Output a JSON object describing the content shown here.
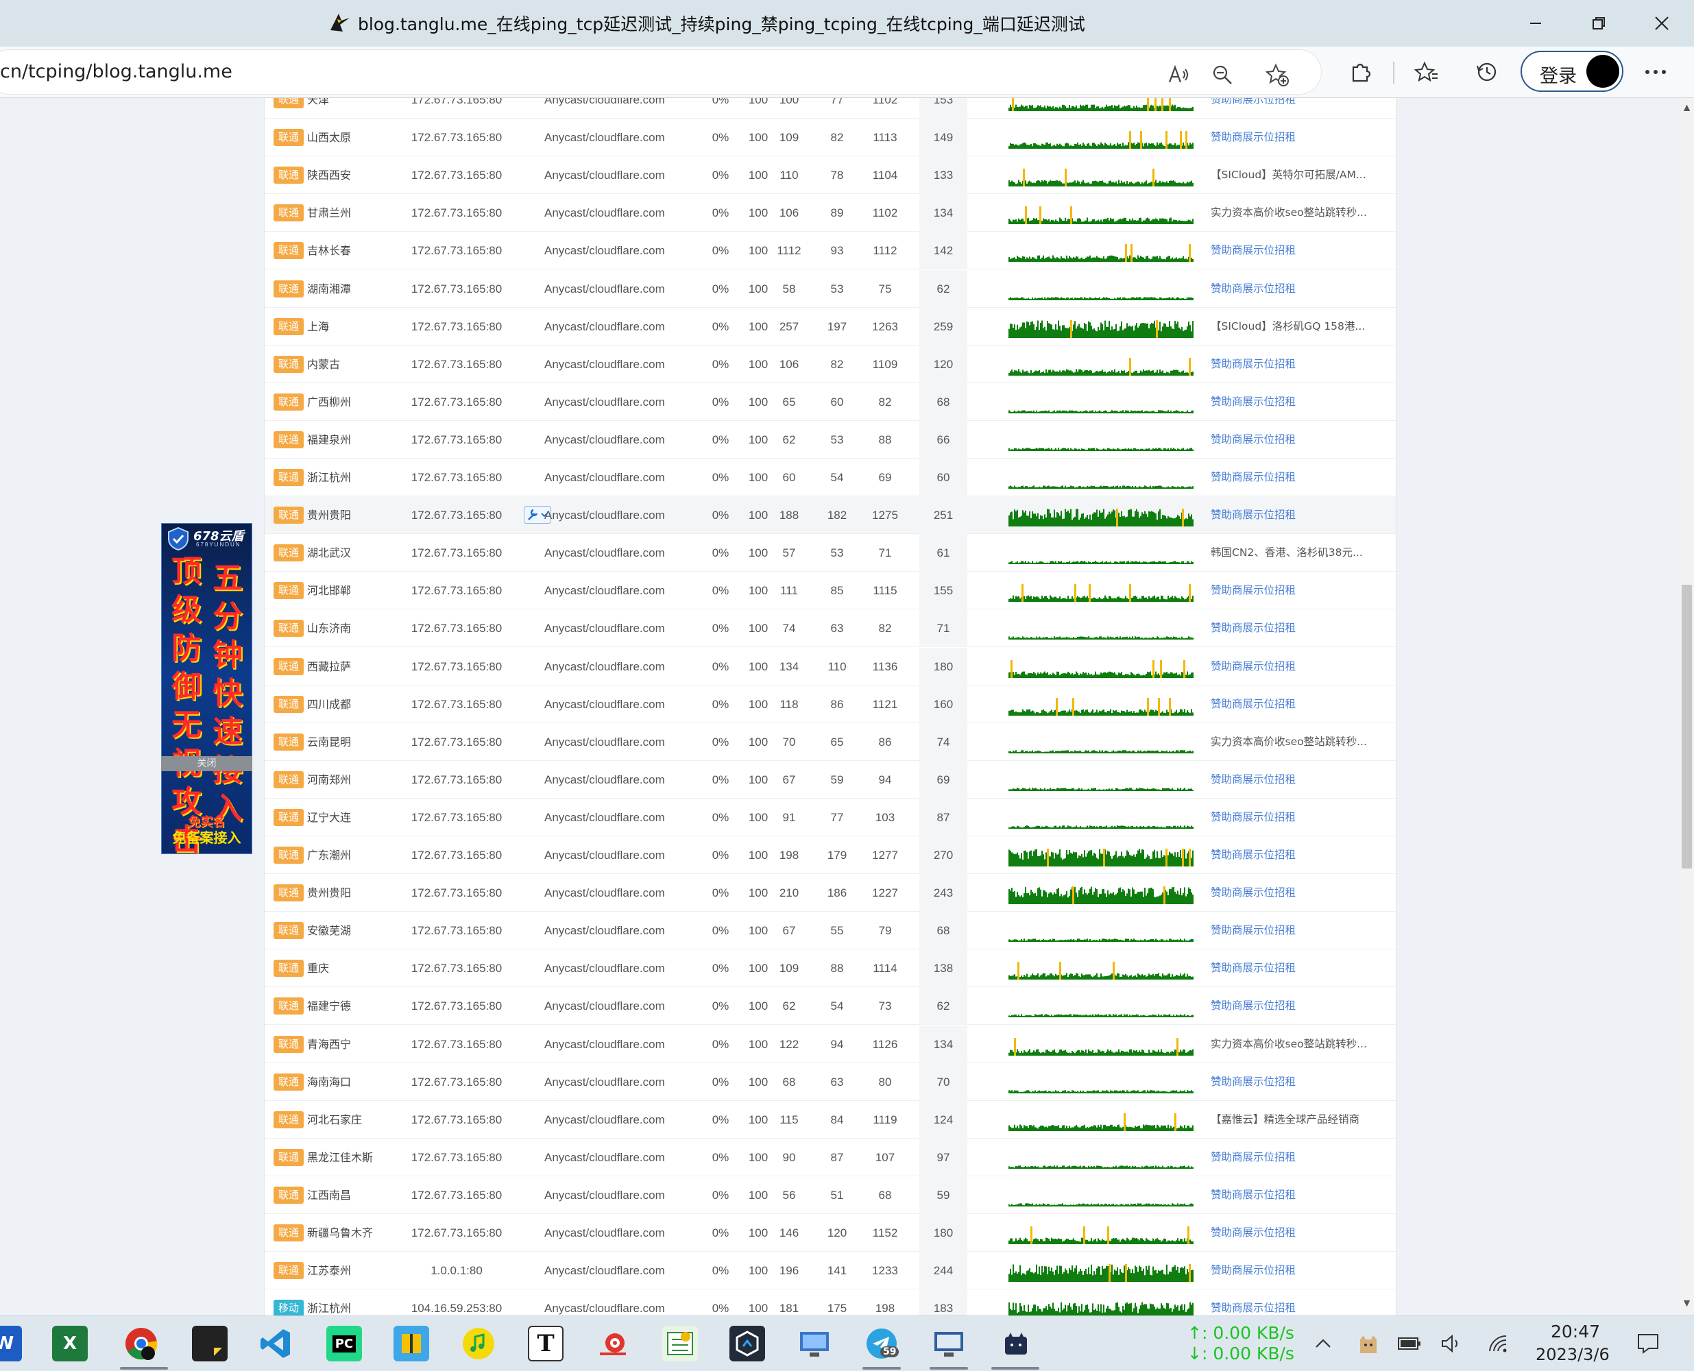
{
  "window": {
    "title": "blog.tanglu.me_在线ping_tcp延迟测试_持续ping_禁ping_tcping_在线tcping_端口延迟测试"
  },
  "browser": {
    "url": "cn/tcping/blog.tanglu.me",
    "login_label": "登录"
  },
  "side_ad": {
    "brand": "678云盾",
    "sub": "678YUNDUN",
    "col1": [
      "顶",
      "级",
      "防",
      "御",
      "无",
      "视",
      "攻",
      "击"
    ],
    "col2": [
      "五",
      "分",
      "钟",
      "快",
      "速",
      "接",
      "入"
    ],
    "foot1": "免实名",
    "foot2": "免备案接入",
    "close": "关闭"
  },
  "colors": {
    "isp_unicom": "#f5a944",
    "isp_mobile": "#35b6d3",
    "graph_ok": "#0f7d0f",
    "graph_spike": "#f2b800",
    "ad_link": "#4a7fd6"
  },
  "rows": [
    {
      "isp": "联通",
      "loc": "天津",
      "ip": "172.67.73.165:80",
      "domain": "Anycast/cloudflare.com",
      "loss": "0%",
      "sent": "100",
      "avg": "100",
      "min": "77",
      "max": "1102",
      "last": "153",
      "ad": "赞助商展示位招租",
      "ad_link": true,
      "level": "mid",
      "spikes": [
        0.02,
        0.76,
        0.8,
        0.84,
        0.88
      ]
    },
    {
      "isp": "联通",
      "loc": "山西太原",
      "ip": "172.67.73.165:80",
      "domain": "Anycast/cloudflare.com",
      "loss": "0%",
      "sent": "100",
      "avg": "109",
      "min": "82",
      "max": "1113",
      "last": "149",
      "ad": "赞助商展示位招租",
      "ad_link": true,
      "level": "mid",
      "spikes": [
        0.66,
        0.72,
        0.86,
        0.94,
        0.97
      ]
    },
    {
      "isp": "联通",
      "loc": "陕西西安",
      "ip": "172.67.73.165:80",
      "domain": "Anycast/cloudflare.com",
      "loss": "0%",
      "sent": "100",
      "avg": "110",
      "min": "78",
      "max": "1104",
      "last": "133",
      "ad": "【SICloud】英特尔可拓展/AM...",
      "ad_link": false,
      "level": "mid",
      "spikes": [
        0.08,
        0.31,
        0.79
      ]
    },
    {
      "isp": "联通",
      "loc": "甘肃兰州",
      "ip": "172.67.73.165:80",
      "domain": "Anycast/cloudflare.com",
      "loss": "0%",
      "sent": "100",
      "avg": "106",
      "min": "89",
      "max": "1102",
      "last": "134",
      "ad": "实力资本高价收seo整站跳转秒...",
      "ad_link": false,
      "level": "mid",
      "spikes": [
        0.09,
        0.17,
        0.34
      ]
    },
    {
      "isp": "联通",
      "loc": "吉林长春",
      "ip": "172.67.73.165:80",
      "domain": "Anycast/cloudflare.com",
      "loss": "0%",
      "sent": "100",
      "avg": "1112",
      "min": "93",
      "max": "1112",
      "last": "142",
      "ad": "赞助商展示位招租",
      "ad_link": true,
      "level": "mid",
      "spikes": [
        0.64,
        0.67,
        0.99
      ]
    },
    {
      "isp": "联通",
      "loc": "湖南湘潭",
      "ip": "172.67.73.165:80",
      "domain": "Anycast/cloudflare.com",
      "loss": "0%",
      "sent": "100",
      "avg": "58",
      "min": "53",
      "max": "75",
      "last": "62",
      "ad": "赞助商展示位招租",
      "ad_link": true,
      "level": "low",
      "spikes": []
    },
    {
      "isp": "联通",
      "loc": "上海",
      "ip": "172.67.73.165:80",
      "domain": "Anycast/cloudflare.com",
      "loss": "0%",
      "sent": "100",
      "avg": "257",
      "min": "197",
      "max": "1263",
      "last": "259",
      "ad": "【SICloud】洛杉矶GQ 158港...",
      "ad_link": false,
      "level": "high",
      "spikes": [
        0.34,
        0.81
      ]
    },
    {
      "isp": "联通",
      "loc": "内蒙古",
      "ip": "172.67.73.165:80",
      "domain": "Anycast/cloudflare.com",
      "loss": "0%",
      "sent": "100",
      "avg": "106",
      "min": "82",
      "max": "1109",
      "last": "120",
      "ad": "赞助商展示位招租",
      "ad_link": true,
      "level": "mid",
      "spikes": [
        0.66,
        0.99
      ]
    },
    {
      "isp": "联通",
      "loc": "广西柳州",
      "ip": "172.67.73.165:80",
      "domain": "Anycast/cloudflare.com",
      "loss": "0%",
      "sent": "100",
      "avg": "65",
      "min": "60",
      "max": "82",
      "last": "68",
      "ad": "赞助商展示位招租",
      "ad_link": true,
      "level": "low",
      "spikes": []
    },
    {
      "isp": "联通",
      "loc": "福建泉州",
      "ip": "172.67.73.165:80",
      "domain": "Anycast/cloudflare.com",
      "loss": "0%",
      "sent": "100",
      "avg": "62",
      "min": "53",
      "max": "88",
      "last": "66",
      "ad": "赞助商展示位招租",
      "ad_link": true,
      "level": "low",
      "spikes": []
    },
    {
      "isp": "联通",
      "loc": "浙江杭州",
      "ip": "172.67.73.165:80",
      "domain": "Anycast/cloudflare.com",
      "loss": "0%",
      "sent": "100",
      "avg": "60",
      "min": "54",
      "max": "69",
      "last": "60",
      "ad": "赞助商展示位招租",
      "ad_link": true,
      "level": "low",
      "spikes": []
    },
    {
      "isp": "联通",
      "loc": "贵州贵阳",
      "ip": "172.67.73.165:80",
      "domain": "Anycast/cloudflare.com",
      "loss": "0%",
      "sent": "100",
      "avg": "188",
      "min": "182",
      "max": "1275",
      "last": "251",
      "ad": "赞助商展示位招租",
      "ad_link": true,
      "level": "high",
      "spikes": [
        0.59,
        0.95
      ],
      "tool": true,
      "highlight": true
    },
    {
      "isp": "联通",
      "loc": "湖北武汉",
      "ip": "172.67.73.165:80",
      "domain": "Anycast/cloudflare.com",
      "loss": "0%",
      "sent": "100",
      "avg": "57",
      "min": "53",
      "max": "71",
      "last": "61",
      "ad": "韩国CN2、香港、洛杉矶38元...",
      "ad_link": false,
      "level": "low",
      "spikes": []
    },
    {
      "isp": "联通",
      "loc": "河北邯郸",
      "ip": "172.67.73.165:80",
      "domain": "Anycast/cloudflare.com",
      "loss": "0%",
      "sent": "100",
      "avg": "111",
      "min": "85",
      "max": "1115",
      "last": "155",
      "ad": "赞助商展示位招租",
      "ad_link": true,
      "level": "mid",
      "spikes": [
        0.07,
        0.36,
        0.44,
        0.66,
        0.99
      ]
    },
    {
      "isp": "联通",
      "loc": "山东济南",
      "ip": "172.67.73.165:80",
      "domain": "Anycast/cloudflare.com",
      "loss": "0%",
      "sent": "100",
      "avg": "74",
      "min": "63",
      "max": "82",
      "last": "71",
      "ad": "赞助商展示位招租",
      "ad_link": true,
      "level": "low",
      "spikes": []
    },
    {
      "isp": "联通",
      "loc": "西藏拉萨",
      "ip": "172.67.73.165:80",
      "domain": "Anycast/cloudflare.com",
      "loss": "0%",
      "sent": "100",
      "avg": "134",
      "min": "110",
      "max": "1136",
      "last": "180",
      "ad": "赞助商展示位招租",
      "ad_link": true,
      "level": "mid",
      "spikes": [
        0.01,
        0.79,
        0.83,
        0.96
      ]
    },
    {
      "isp": "联通",
      "loc": "四川成都",
      "ip": "172.67.73.165:80",
      "domain": "Anycast/cloudflare.com",
      "loss": "0%",
      "sent": "100",
      "avg": "118",
      "min": "86",
      "max": "1121",
      "last": "160",
      "ad": "赞助商展示位招租",
      "ad_link": true,
      "level": "mid",
      "spikes": [
        0.26,
        0.35,
        0.76,
        0.82,
        0.88
      ]
    },
    {
      "isp": "联通",
      "loc": "云南昆明",
      "ip": "172.67.73.165:80",
      "domain": "Anycast/cloudflare.com",
      "loss": "0%",
      "sent": "100",
      "avg": "70",
      "min": "65",
      "max": "86",
      "last": "74",
      "ad": "实力资本高价收seo整站跳转秒...",
      "ad_link": false,
      "level": "low",
      "spikes": []
    },
    {
      "isp": "联通",
      "loc": "河南郑州",
      "ip": "172.67.73.165:80",
      "domain": "Anycast/cloudflare.com",
      "loss": "0%",
      "sent": "100",
      "avg": "67",
      "min": "59",
      "max": "94",
      "last": "69",
      "ad": "赞助商展示位招租",
      "ad_link": true,
      "level": "low",
      "spikes": []
    },
    {
      "isp": "联通",
      "loc": "辽宁大连",
      "ip": "172.67.73.165:80",
      "domain": "Anycast/cloudflare.com",
      "loss": "0%",
      "sent": "100",
      "avg": "91",
      "min": "77",
      "max": "103",
      "last": "87",
      "ad": "赞助商展示位招租",
      "ad_link": true,
      "level": "low",
      "spikes": []
    },
    {
      "isp": "联通",
      "loc": "广东潮州",
      "ip": "172.67.73.165:80",
      "domain": "Anycast/cloudflare.com",
      "loss": "0%",
      "sent": "100",
      "avg": "198",
      "min": "179",
      "max": "1277",
      "last": "270",
      "ad": "赞助商展示位招租",
      "ad_link": true,
      "level": "high",
      "spikes": [
        0.21,
        0.52,
        0.86,
        0.95,
        0.99
      ]
    },
    {
      "isp": "联通",
      "loc": "贵州贵阳",
      "ip": "172.67.73.165:80",
      "domain": "Anycast/cloudflare.com",
      "loss": "0%",
      "sent": "100",
      "avg": "210",
      "min": "186",
      "max": "1227",
      "last": "243",
      "ad": "赞助商展示位招租",
      "ad_link": true,
      "level": "high",
      "spikes": [
        0.35,
        0.85
      ]
    },
    {
      "isp": "联通",
      "loc": "安徽芜湖",
      "ip": "172.67.73.165:80",
      "domain": "Anycast/cloudflare.com",
      "loss": "0%",
      "sent": "100",
      "avg": "67",
      "min": "55",
      "max": "79",
      "last": "68",
      "ad": "赞助商展示位招租",
      "ad_link": true,
      "level": "low",
      "spikes": []
    },
    {
      "isp": "联通",
      "loc": "重庆",
      "ip": "172.67.73.165:80",
      "domain": "Anycast/cloudflare.com",
      "loss": "0%",
      "sent": "100",
      "avg": "109",
      "min": "88",
      "max": "1114",
      "last": "138",
      "ad": "赞助商展示位招租",
      "ad_link": true,
      "level": "mid",
      "spikes": [
        0.05,
        0.28,
        0.57
      ]
    },
    {
      "isp": "联通",
      "loc": "福建宁德",
      "ip": "172.67.73.165:80",
      "domain": "Anycast/cloudflare.com",
      "loss": "0%",
      "sent": "100",
      "avg": "62",
      "min": "54",
      "max": "73",
      "last": "62",
      "ad": "赞助商展示位招租",
      "ad_link": true,
      "level": "low",
      "spikes": []
    },
    {
      "isp": "联通",
      "loc": "青海西宁",
      "ip": "172.67.73.165:80",
      "domain": "Anycast/cloudflare.com",
      "loss": "0%",
      "sent": "100",
      "avg": "122",
      "min": "94",
      "max": "1126",
      "last": "134",
      "ad": "实力资本高价收seo整站跳转秒...",
      "ad_link": false,
      "level": "mid",
      "spikes": [
        0.03,
        0.92
      ]
    },
    {
      "isp": "联通",
      "loc": "海南海口",
      "ip": "172.67.73.165:80",
      "domain": "Anycast/cloudflare.com",
      "loss": "0%",
      "sent": "100",
      "avg": "68",
      "min": "63",
      "max": "80",
      "last": "70",
      "ad": "赞助商展示位招租",
      "ad_link": true,
      "level": "low",
      "spikes": []
    },
    {
      "isp": "联通",
      "loc": "河北石家庄",
      "ip": "172.67.73.165:80",
      "domain": "Anycast/cloudflare.com",
      "loss": "0%",
      "sent": "100",
      "avg": "115",
      "min": "84",
      "max": "1119",
      "last": "124",
      "ad": "【嘉惟云】精选全球产品经销商",
      "ad_link": false,
      "level": "mid",
      "spikes": [
        0.63,
        0.91
      ]
    },
    {
      "isp": "联通",
      "loc": "黑龙江佳木斯",
      "ip": "172.67.73.165:80",
      "domain": "Anycast/cloudflare.com",
      "loss": "0%",
      "sent": "100",
      "avg": "90",
      "min": "87",
      "max": "107",
      "last": "97",
      "ad": "赞助商展示位招租",
      "ad_link": true,
      "level": "low",
      "spikes": []
    },
    {
      "isp": "联通",
      "loc": "江西南昌",
      "ip": "172.67.73.165:80",
      "domain": "Anycast/cloudflare.com",
      "loss": "0%",
      "sent": "100",
      "avg": "56",
      "min": "51",
      "max": "68",
      "last": "59",
      "ad": "赞助商展示位招租",
      "ad_link": true,
      "level": "low",
      "spikes": []
    },
    {
      "isp": "联通",
      "loc": "新疆乌鲁木齐",
      "ip": "172.67.73.165:80",
      "domain": "Anycast/cloudflare.com",
      "loss": "0%",
      "sent": "100",
      "avg": "146",
      "min": "120",
      "max": "1152",
      "last": "180",
      "ad": "赞助商展示位招租",
      "ad_link": true,
      "level": "mid",
      "spikes": [
        0.12,
        0.41,
        0.54,
        0.98
      ]
    },
    {
      "isp": "联通",
      "loc": "江苏泰州",
      "ip": "1.0.0.1:80",
      "domain": "Anycast/cloudflare.com",
      "loss": "0%",
      "sent": "100",
      "avg": "196",
      "min": "141",
      "max": "1233",
      "last": "244",
      "ad": "赞助商展示位招租",
      "ad_link": true,
      "level": "high",
      "spikes": [
        0.55,
        0.64,
        0.99
      ]
    },
    {
      "isp": "移动",
      "loc": "浙江杭州",
      "ip": "104.16.59.253:80",
      "domain": "Anycast/cloudflare.com",
      "loss": "0%",
      "sent": "100",
      "avg": "181",
      "min": "175",
      "max": "198",
      "last": "183",
      "ad": "赞助商展示位招租",
      "ad_link": true,
      "level": "high",
      "spikes": []
    }
  ],
  "taskbar": {
    "net_up": "↑: 0.00 KB/s",
    "net_down": "↓: 0.00 KB/s",
    "time": "20:47",
    "date": "2023/3/6",
    "badge_count": "59"
  }
}
